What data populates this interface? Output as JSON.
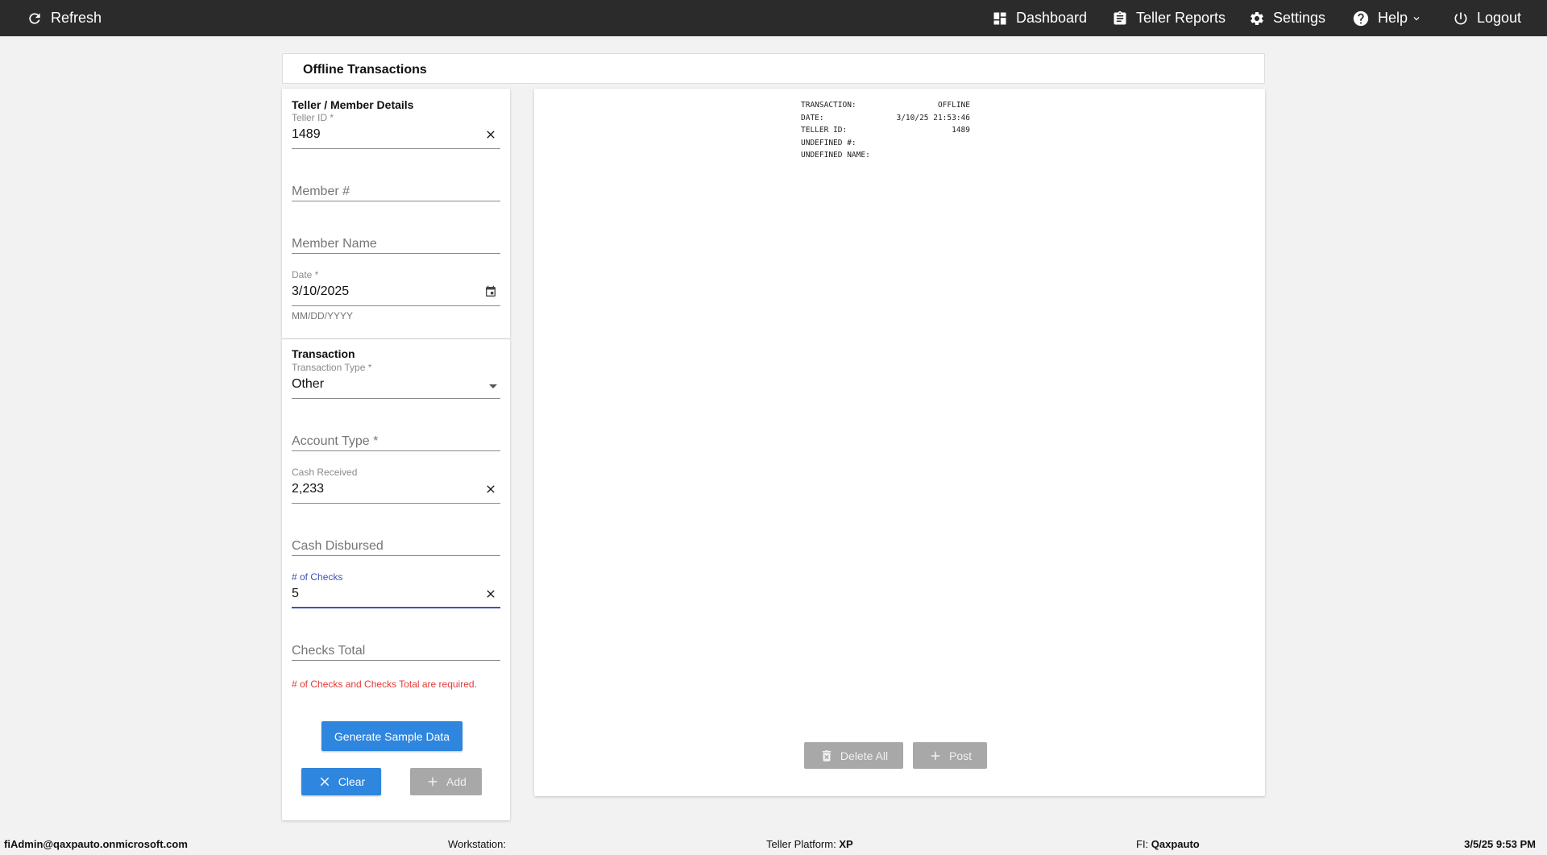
{
  "topbar": {
    "refresh": "Refresh",
    "dashboard": "Dashboard",
    "teller_reports": "Teller Reports",
    "settings": "Settings",
    "help": "Help",
    "logout": "Logout"
  },
  "page": {
    "title": "Offline Transactions"
  },
  "member_details": {
    "title": "Teller / Member Details",
    "teller_id_label": "Teller ID *",
    "teller_id_value": "1489",
    "member_number_placeholder": "Member #",
    "member_name_placeholder": "Member Name",
    "date_label": "Date *",
    "date_value": "3/10/2025",
    "date_helper": "MM/DD/YYYY"
  },
  "transaction": {
    "title": "Transaction",
    "type_label": "Transaction Type *",
    "type_value": "Other",
    "account_type_placeholder": "Account Type *",
    "cash_received_label": "Cash Received",
    "cash_received_value": "2,233",
    "cash_disbursed_placeholder": "Cash Disbursed",
    "checks_count_label": "# of Checks",
    "checks_count_value": "5",
    "checks_total_placeholder": "Checks Total",
    "error": "# of Checks and Checks Total are required."
  },
  "buttons": {
    "generate": "Generate Sample Data",
    "clear": "Clear",
    "add": "Add",
    "delete_all": "Delete All",
    "post": "Post"
  },
  "receipt": {
    "rows": [
      {
        "label": "TRANSACTION:",
        "value": "OFFLINE"
      },
      {
        "label": "DATE:",
        "value": "3/10/25 21:53:46"
      },
      {
        "label": "TELLER ID:",
        "value": "1489"
      },
      {
        "label": "UNDEFINED #:",
        "value": ""
      },
      {
        "label": "UNDEFINED NAME:",
        "value": ""
      }
    ]
  },
  "footer": {
    "user": "fiAdmin@qaxpauto.onmicrosoft.com",
    "workstation_label": "Workstation:",
    "workstation_value": "",
    "platform_label": "Teller Platform:",
    "platform_value": "XP",
    "fi_label": "FI:",
    "fi_value": "Qaxpauto",
    "datetime": "3/5/25 9:53 PM"
  },
  "colors": {
    "topbar": "#2b2b2b",
    "primary": "#2e86de",
    "focus": "#3f51b5",
    "error": "#e53935",
    "disabled": "#a8a8a8"
  }
}
